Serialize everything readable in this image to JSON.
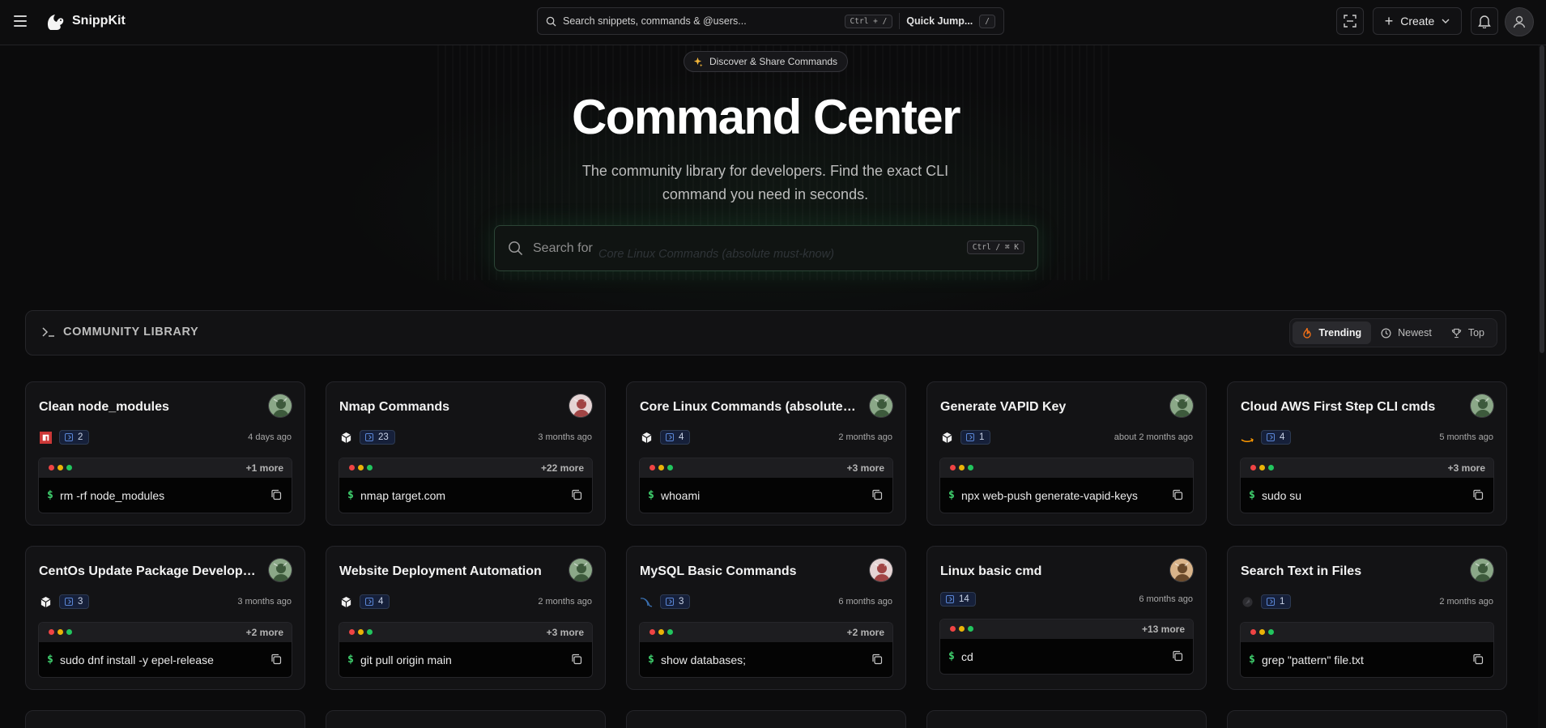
{
  "header": {
    "brand": "SnippKit",
    "search_placeholder": "Search snippets, commands & @users...",
    "search_shortcut": "Ctrl + /",
    "quick_jump_label": "Quick Jump...",
    "quick_jump_shortcut": "/",
    "create_label": "Create"
  },
  "hero": {
    "pill": "Discover & Share Commands",
    "title": "Command Center",
    "subtitle": "The community library for developers. Find the exact CLI command you need in seconds.",
    "search_label": "Search for",
    "search_typed": "Core Linux Commands (absolute must-know)",
    "search_shortcut": "Ctrl / ⌘ K"
  },
  "library": {
    "title": "COMMUNITY LIBRARY",
    "sort": [
      {
        "label": "Trending",
        "active": true,
        "icon": "flame-icon"
      },
      {
        "label": "Newest",
        "active": false,
        "icon": "clock-icon"
      },
      {
        "label": "Top",
        "active": false,
        "icon": "trophy-icon"
      }
    ]
  },
  "cards": [
    {
      "title": "Clean node_modules",
      "tech": "npm-icon",
      "count": "2",
      "time": "4 days ago",
      "more": "+1 more",
      "command": "rm -rf node_modules"
    },
    {
      "title": "Nmap Commands",
      "tech": "cube-icon",
      "count": "23",
      "time": "3 months ago",
      "more": "+22 more",
      "command": "nmap target.com"
    },
    {
      "title": "Core Linux Commands (absolute mu...",
      "tech": "cube-icon",
      "count": "4",
      "time": "2 months ago",
      "more": "+3 more",
      "command": "whoami"
    },
    {
      "title": "Generate VAPID Key",
      "tech": "cube-icon",
      "count": "1",
      "time": "about 2 months ago",
      "more": "",
      "command": "npx web-push generate-vapid-keys"
    },
    {
      "title": "Cloud AWS First Step CLI cmds",
      "tech": "aws-icon",
      "count": "4",
      "time": "5 months ago",
      "more": "+3 more",
      "command": "sudo su"
    },
    {
      "title": "CentOs Update Package Developme...",
      "tech": "cube-icon",
      "count": "3",
      "time": "3 months ago",
      "more": "+2 more",
      "command": "sudo dnf install -y epel-release"
    },
    {
      "title": "Website Deployment Automation",
      "tech": "cube-icon",
      "count": "4",
      "time": "2 months ago",
      "more": "+3 more",
      "command": "git pull origin main"
    },
    {
      "title": "MySQL Basic Commands",
      "tech": "mysql-icon",
      "count": "3",
      "time": "6 months ago",
      "more": "+2 more",
      "command": "show databases;"
    },
    {
      "title": "Linux basic cmd",
      "tech": "",
      "count": "14",
      "time": "6 months ago",
      "more": "+13 more",
      "command": "cd"
    },
    {
      "title": "Search Text in Files",
      "tech": "gray-logo-icon",
      "count": "1",
      "time": "2 months ago",
      "more": "",
      "command": "grep \"pattern\" file.txt"
    }
  ],
  "colors": {
    "dot_red": "#ef4444",
    "dot_yellow": "#eab308",
    "dot_green": "#22c55e",
    "prompt": "#3fcf6d",
    "accent_flame": "#f97316"
  }
}
